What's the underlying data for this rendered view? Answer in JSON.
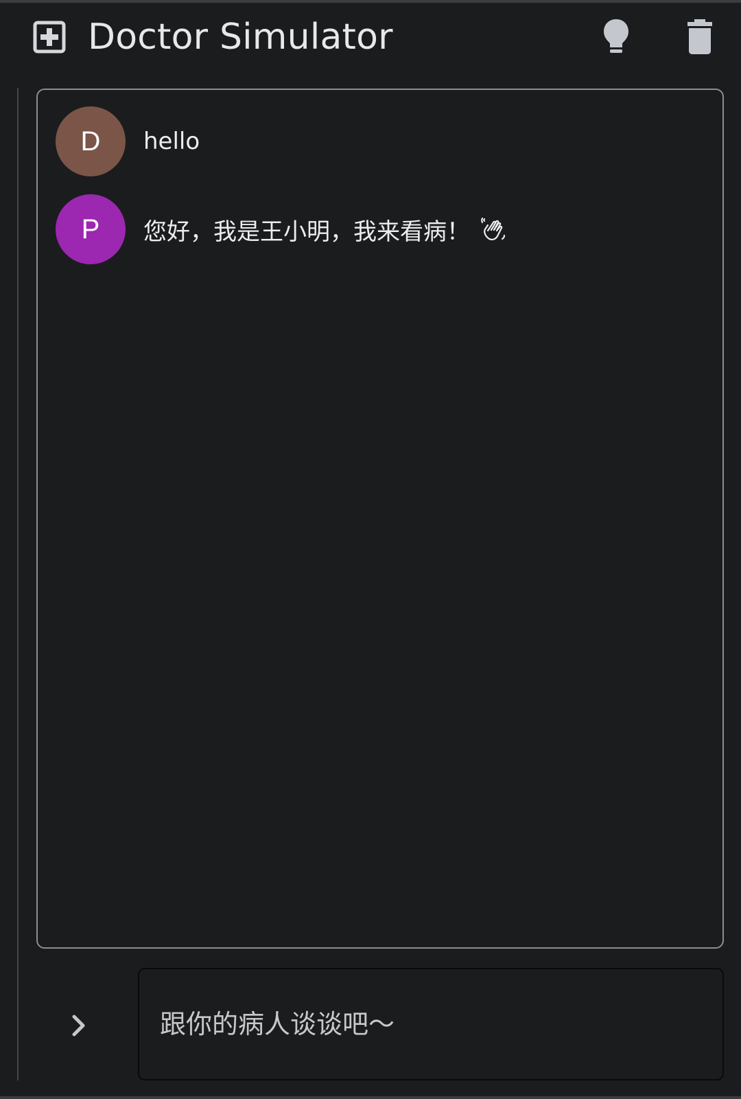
{
  "app": {
    "title": "Doctor Simulator"
  },
  "header": {
    "actions": [
      {
        "name": "hint",
        "icon": "lightbulb-icon"
      },
      {
        "name": "delete",
        "icon": "trash-icon"
      }
    ]
  },
  "chat": {
    "messages": [
      {
        "avatar_letter": "D",
        "avatar_color": "#7b5548",
        "role": "doctor",
        "text": "hello"
      },
      {
        "avatar_letter": "P",
        "avatar_color": "#9c27b0",
        "role": "patient",
        "text": "您好，我是王小明，我来看病！",
        "emoji": "waving-hand-icon"
      }
    ]
  },
  "composer": {
    "placeholder": "跟你的病人谈谈吧～",
    "value": "",
    "send_icon": "chevron-right-icon"
  },
  "colors": {
    "background": "#1b1c1e",
    "panel_border": "#8c8e93",
    "icon": "#c4c7ce"
  }
}
